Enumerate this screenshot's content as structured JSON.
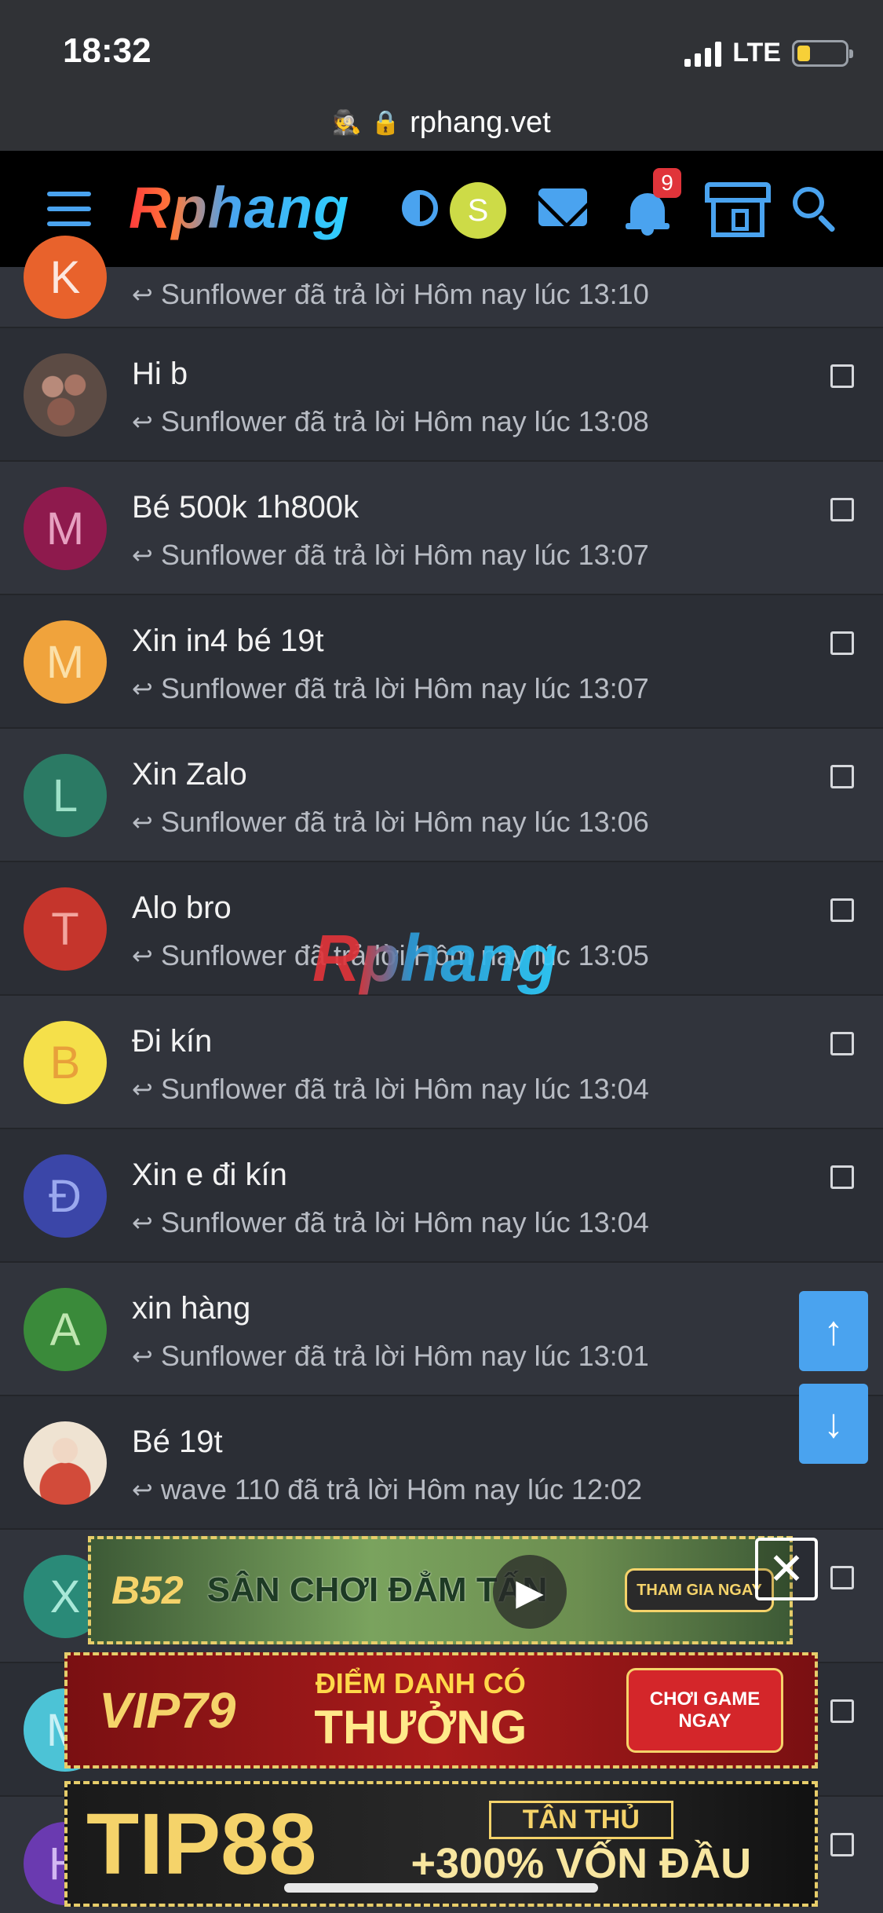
{
  "status": {
    "time": "18:32",
    "network": "LTE",
    "battery_level": 0.28
  },
  "browser": {
    "url": "rphang.vet"
  },
  "header": {
    "logo": "Rphang",
    "user_initial": "S",
    "notification_count": "9",
    "accent_color": "#4aa3ef"
  },
  "conversations": [
    {
      "initial": "K",
      "color": "#e8622c",
      "title": "",
      "meta": "Sunflower đã trả lời Hôm nay lúc 13:10"
    },
    {
      "initial": "",
      "color": "#5c4b44",
      "title": "Hi b",
      "meta": "Sunflower đã trả lời Hôm nay lúc 13:08"
    },
    {
      "initial": "M",
      "color": "#8e1a4d",
      "title": "Bé 500k 1h800k",
      "meta": "Sunflower đã trả lời Hôm nay lúc 13:07"
    },
    {
      "initial": "M",
      "color": "#f0a33c",
      "title": "Xin in4 bé 19t",
      "meta": "Sunflower đã trả lời Hôm nay lúc 13:07"
    },
    {
      "initial": "L",
      "color": "#2b7a64",
      "title": "Xin Zalo",
      "meta": "Sunflower đã trả lời Hôm nay lúc 13:06"
    },
    {
      "initial": "T",
      "color": "#c5352c",
      "title": "Alo bro",
      "meta": "Sunflower đã trả lời Hôm nay lúc 13:05"
    },
    {
      "initial": "B",
      "color": "#f5e04a",
      "title": "Đi kín",
      "meta": "Sunflower đã trả lời Hôm nay lúc 13:04"
    },
    {
      "initial": "Đ",
      "color": "#3b46a8",
      "title": "Xin e đi kín",
      "meta": "Sunflower đã trả lời Hôm nay lúc 13:04"
    },
    {
      "initial": "A",
      "color": "#3a8a3a",
      "title": "xin hàng",
      "meta": "Sunflower đã trả lời Hôm nay lúc 13:01"
    },
    {
      "initial": "",
      "color": "#efe3d2",
      "title": "Bé 19t",
      "meta": "wave 110 đã trả lời Hôm nay lúc 12:02"
    },
    {
      "initial": "X",
      "color": "#2a8a78",
      "title": "",
      "meta": ""
    },
    {
      "initial": "M",
      "color": "#4cc3d6",
      "title": "",
      "meta": ""
    },
    {
      "initial": "H",
      "color": "#6a3ab0",
      "title": "",
      "meta": ""
    }
  ],
  "watermark": "Rphang",
  "ads": {
    "b52": {
      "logo": "B52",
      "text": "SÂN CHƠI ĐẲM TẤN",
      "cta": "THAM GIA NGAY"
    },
    "vip79": {
      "logo": "VIP79",
      "line1": "ĐIỂM DANH CÓ",
      "line2": "THƯỞNG",
      "cta": "CHƠI GAME NGAY"
    },
    "tip88": {
      "logo": "TIP88",
      "line1": "TÂN THỦ",
      "line2": "+300% VỐN ĐẦU"
    }
  }
}
